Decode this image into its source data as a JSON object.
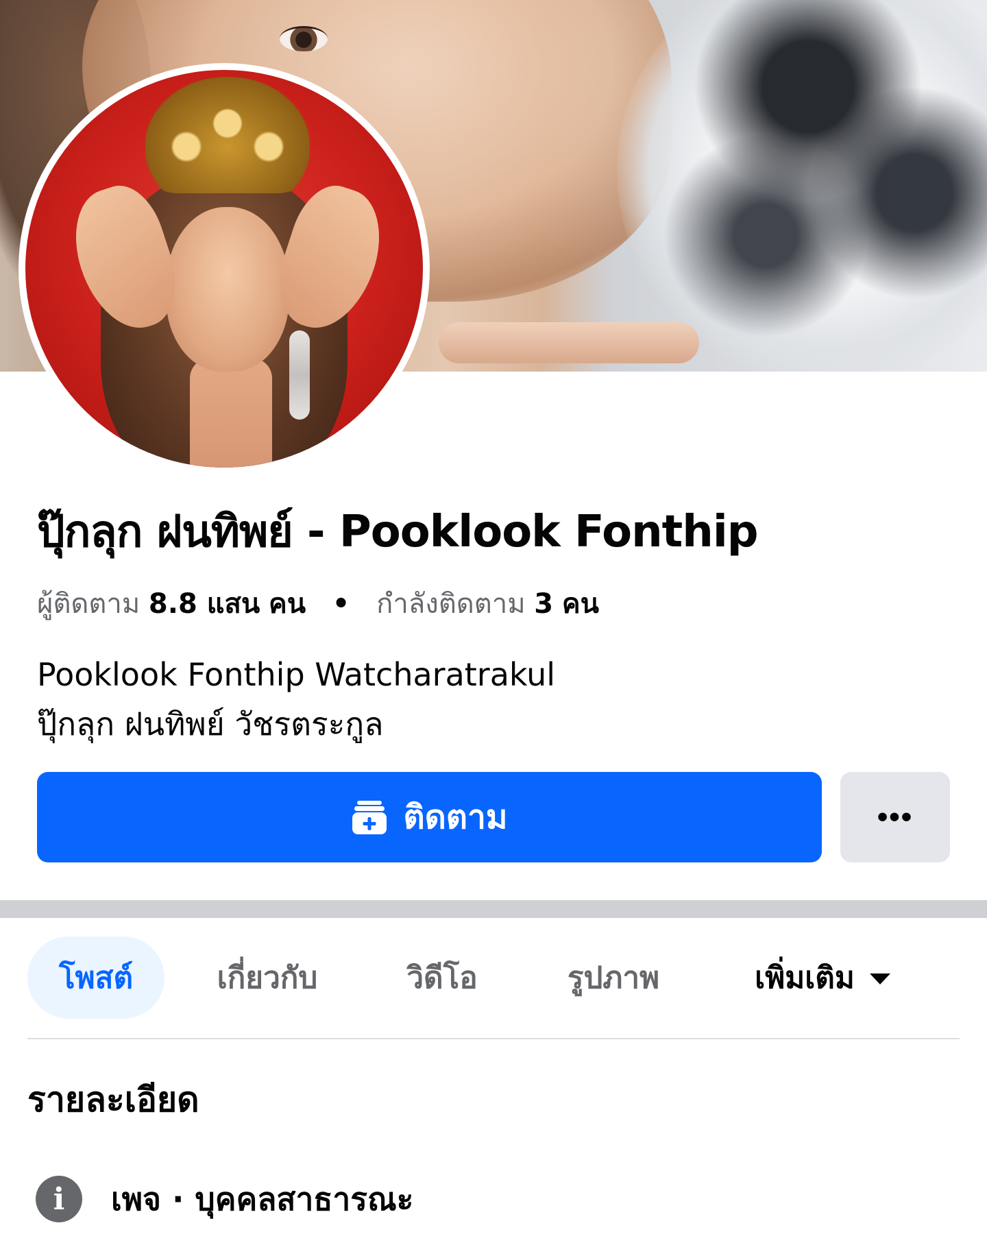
{
  "profile": {
    "name": "ปุ๊กลุก ฝนทิพย์ - Pooklook Fonthip",
    "followers_label": "ผู้ติดตาม",
    "followers_count": "8.8 แสน",
    "followers_unit": "คน",
    "separator": "•",
    "following_label": "กำลังติดตาม",
    "following_count": "3",
    "following_unit": "คน",
    "bio_line1": "Pooklook Fonthip Watcharatrakul",
    "bio_line2": "ปุ๊กลุก ฝนทิพย์ วัชรตระกูล"
  },
  "actions": {
    "follow_label": "ติดตาม",
    "follow_icon": "follow-add-icon",
    "more_icon": "more-ellipsis-icon",
    "more_glyph": "•••"
  },
  "tabs": [
    {
      "label": "โพสต์",
      "active": true
    },
    {
      "label": "เกี่ยวกับ",
      "active": false
    },
    {
      "label": "วิดีโอ",
      "active": false
    },
    {
      "label": "รูปภาพ",
      "active": false
    },
    {
      "label": "เพิ่มเติม",
      "active": false,
      "dropdown": true
    }
  ],
  "details": {
    "title": "รายละเอียด",
    "category_icon": "info-icon",
    "category_glyph": "i",
    "category_text": "เพจ · บุคคลสาธารณะ"
  },
  "colors": {
    "accent": "#0866ff",
    "active_tab_bg": "#ebf5ff",
    "secondary_text": "#65676b",
    "more_button_bg": "#e4e6eb",
    "divider": "#ced0d4"
  }
}
